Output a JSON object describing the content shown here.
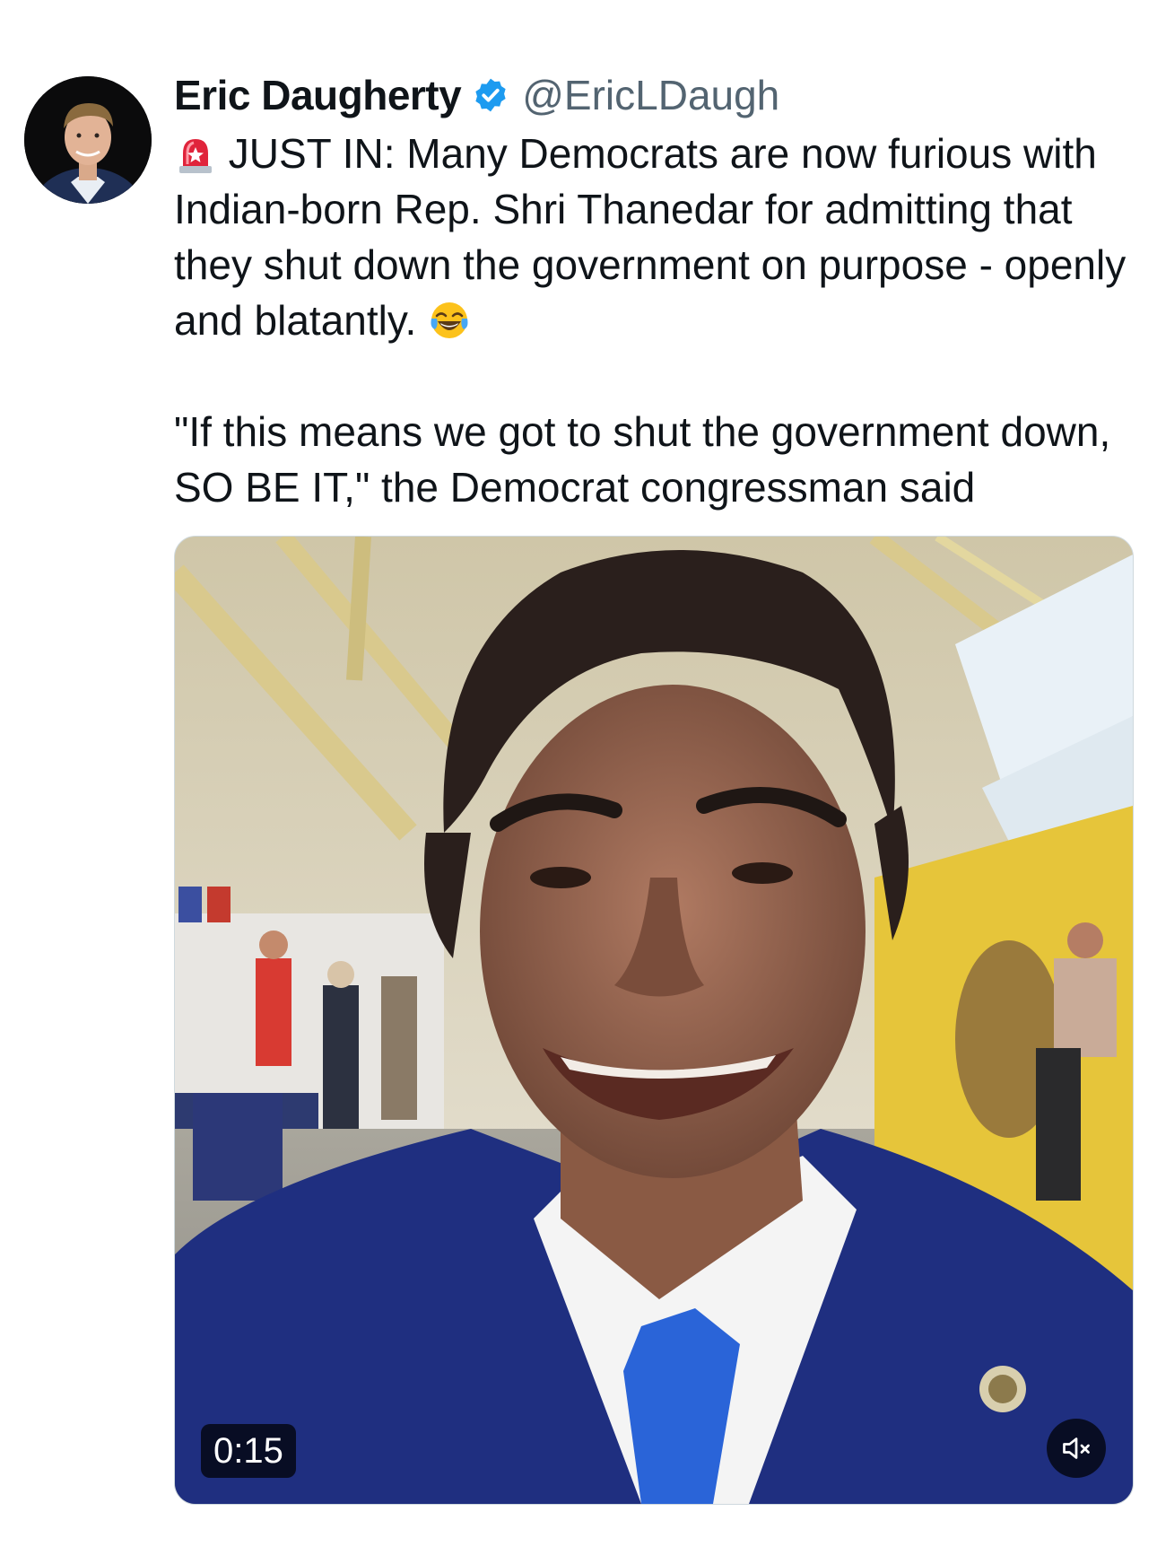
{
  "author": {
    "display_name": "Eric Daugherty",
    "handle": "@EricLDaugh",
    "verified": true,
    "avatar_icon": "avatar-photo"
  },
  "tweet": {
    "lead_emoji": "rotating-light-emoji",
    "paragraph_1": "JUST IN: Many Democrats are now furious with Indian-born Rep. Shri Thanedar for admitting that they shut down the government on purpose - openly and blatantly.",
    "trailing_emoji": "face-with-tears-of-joy-emoji",
    "paragraph_2": "\"If this means we got to shut the government down, SO BE IT,\" the Democrat congressman said"
  },
  "video": {
    "duration": "0:15",
    "muted": true,
    "mute_icon": "speaker-muted-icon"
  },
  "colors": {
    "text": "#0f1419",
    "secondary_text": "#536471",
    "verified_badge": "#1d9bf0",
    "overlay": "#000000"
  }
}
